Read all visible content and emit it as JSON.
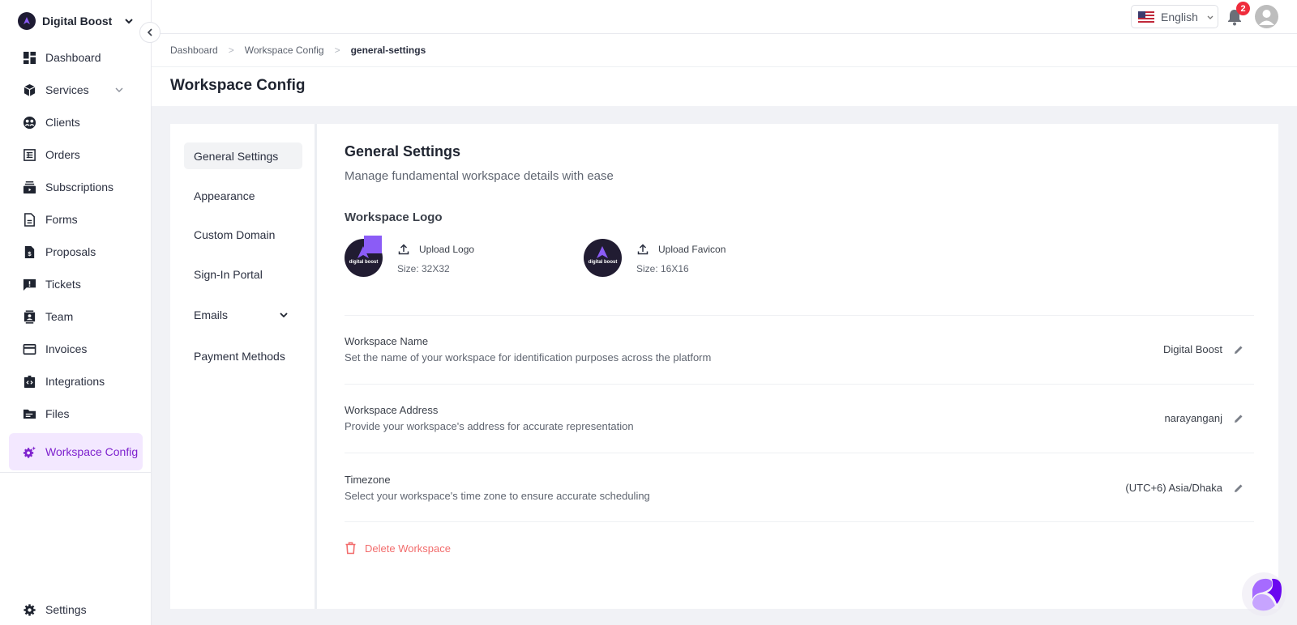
{
  "brand": {
    "name": "Digital Boost",
    "logo_text": "digital boost"
  },
  "sidebar": {
    "items": [
      {
        "label": "Dashboard",
        "icon": "dashboard-icon"
      },
      {
        "label": "Services",
        "icon": "box-icon",
        "has_submenu": true
      },
      {
        "label": "Clients",
        "icon": "clients-icon"
      },
      {
        "label": "Orders",
        "icon": "orders-icon"
      },
      {
        "label": "Subscriptions",
        "icon": "subscriptions-icon"
      },
      {
        "label": "Forms",
        "icon": "document-icon"
      },
      {
        "label": "Proposals",
        "icon": "proposal-icon"
      },
      {
        "label": "Tickets",
        "icon": "ticket-icon"
      },
      {
        "label": "Team",
        "icon": "team-icon"
      },
      {
        "label": "Invoices",
        "icon": "credit-card-icon"
      },
      {
        "label": "Integrations",
        "icon": "code-icon"
      },
      {
        "label": "Files",
        "icon": "folder-icon"
      },
      {
        "label": "Workspace Config",
        "icon": "gear-sparkle-icon",
        "active": true
      }
    ],
    "settings_label": "Settings",
    "active_color": "#7e22ce"
  },
  "header": {
    "language": "English",
    "notification_count": "2"
  },
  "breadcrumb": {
    "items": [
      "Dashboard",
      "Workspace Config"
    ],
    "current": "general-settings"
  },
  "page": {
    "title": "Workspace Config"
  },
  "subnav": {
    "items": [
      {
        "label": "General Settings",
        "active": true
      },
      {
        "label": "Appearance"
      },
      {
        "label": "Custom Domain"
      },
      {
        "label": "Sign-In Portal"
      },
      {
        "label": "Emails",
        "has_submenu": true
      },
      {
        "label": "Payment Methods"
      }
    ]
  },
  "general": {
    "title": "General Settings",
    "subtitle": "Manage fundamental workspace details with ease",
    "logo_heading": "Workspace Logo",
    "logo_upload_label": "Upload Logo",
    "logo_size": "Size: 32X32",
    "favicon_upload_label": "Upload Favicon",
    "favicon_size": "Size: 16X16",
    "rows": [
      {
        "label": "Workspace Name",
        "description": "Set the name of your workspace for identification purposes across the platform",
        "value": "Digital Boost"
      },
      {
        "label": "Workspace Address",
        "description": "Provide your workspace's address for accurate representation",
        "value": "narayanganj"
      },
      {
        "label": "Timezone",
        "description": "Select your workspace's time zone to ensure accurate scheduling",
        "value": "(UTC+6) Asia/Dhaka"
      }
    ],
    "delete_label": "Delete Workspace",
    "delete_color": "#f26c6c"
  }
}
